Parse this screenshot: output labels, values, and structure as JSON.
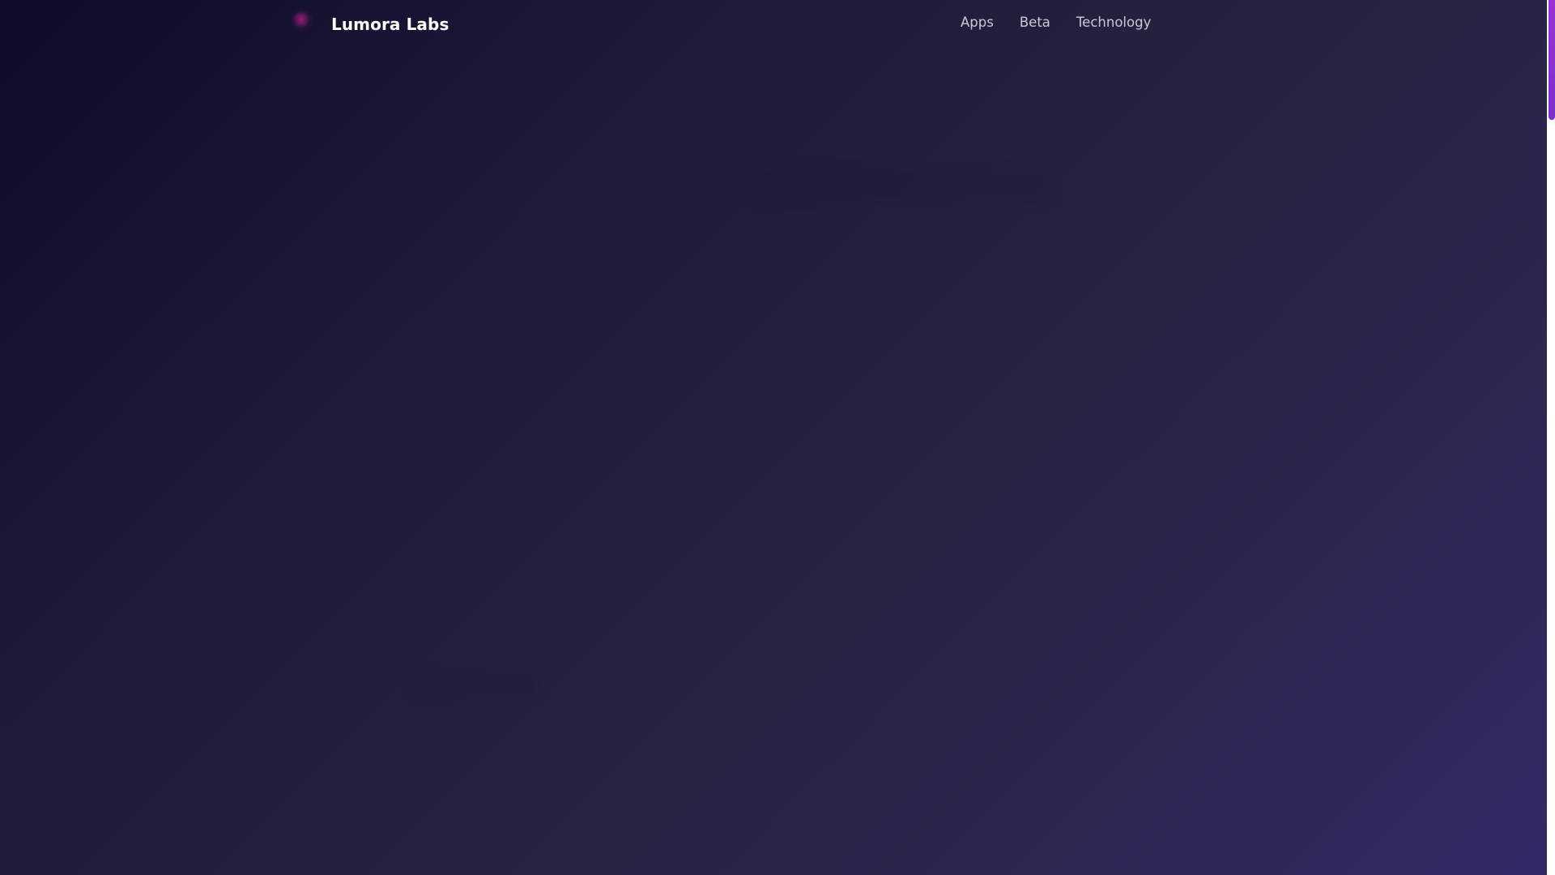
{
  "header": {
    "brand_name": "Lumora Labs",
    "logo_icon": "orb-logo-icon",
    "nav": [
      {
        "label": "Apps"
      },
      {
        "label": "Beta"
      },
      {
        "label": "Technology"
      }
    ]
  },
  "colors": {
    "background_start": "#0f0b28",
    "background_end": "#322a66",
    "scrollbar_thumb": "#9a33d8",
    "nav_text": "#c9c9d6",
    "brand_text": "#ffffff"
  },
  "scroll": {
    "position_fraction": 0
  }
}
